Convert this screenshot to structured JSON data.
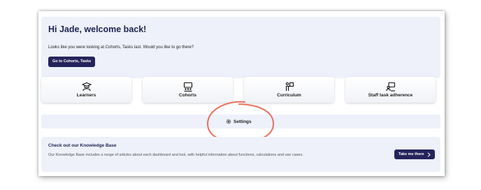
{
  "welcome": {
    "title": "Hi Jade, welcome back!",
    "subtitle": "Looks like you were looking at Cohorts, Tasks last. Would you like to go there?",
    "button_label": "Go to Cohorts, Tasks"
  },
  "tiles": [
    {
      "label": "Learners",
      "icon": "learners-icon"
    },
    {
      "label": "Cohorts",
      "icon": "cohorts-icon"
    },
    {
      "label": "Curriculum",
      "icon": "curriculum-icon"
    },
    {
      "label": "Staff task adherence",
      "icon": "staff-task-icon"
    }
  ],
  "settings": {
    "label": "Settings",
    "icon": "gear-icon"
  },
  "knowledge_base": {
    "title": "Check out our Knowledge Base",
    "description": "Our Knowledge Base includes a range of articles about each dashboard and tool, with helpful information about functions, calculations and use cases.",
    "button_label": "Take me there"
  },
  "colors": {
    "primary_dark": "#24245c",
    "panel_bg": "#eef1fa",
    "annotation_red": "#e8715e"
  }
}
